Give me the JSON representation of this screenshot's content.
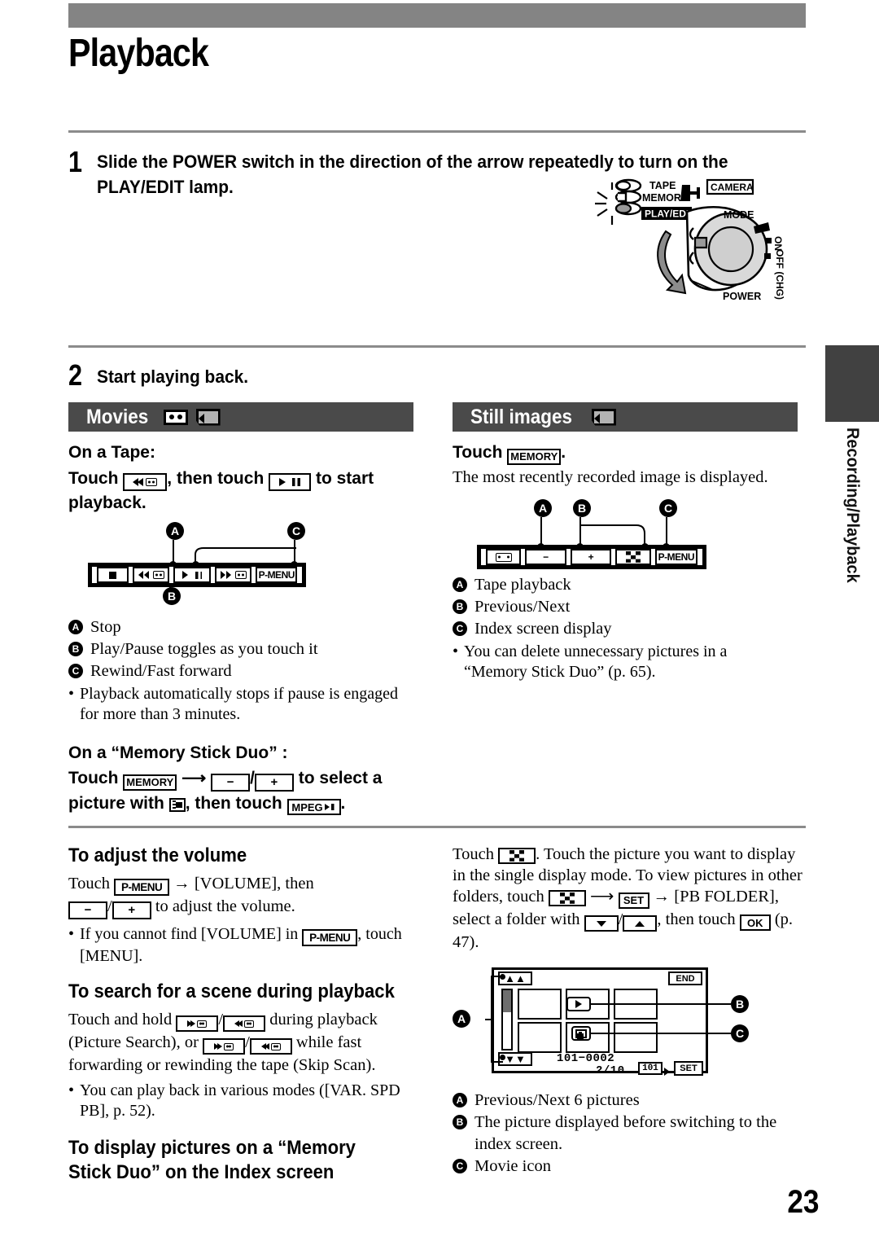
{
  "page": {
    "chapter_title": "Playback",
    "page_number": "23",
    "side_tab_label": "Recording/Playback"
  },
  "steps": [
    {
      "number": "1",
      "text": "Slide the POWER switch in the direction of the arrow repeatedly to turn on the PLAY/EDIT lamp."
    },
    {
      "number": "2",
      "text": "Start playing back."
    }
  ],
  "power_switch": {
    "lamps": [
      "TAPE",
      "MEMORY",
      "PLAY/EDIT"
    ],
    "mode_label": "MODE",
    "camera_label": "CAMERA",
    "power_label": "POWER",
    "on_label": "ON",
    "off_label": "OFF (CHG)"
  },
  "movies": {
    "bar_label": "Movies",
    "bar_icons": [
      "tape-icon",
      "memory-stick-icon"
    ],
    "tape_heading": "On a Tape:",
    "tape_instruction_pre": "Touch",
    "tape_instruction_mid": ", then touch",
    "tape_instruction_post": "to start playback.",
    "control_bar": {
      "buttons": [
        "stop",
        "rewind",
        "play-pause",
        "fast-forward",
        "P-MENU"
      ],
      "pmenu_label": "P-MENU",
      "callouts": [
        "A",
        "B",
        "C"
      ]
    },
    "legend": [
      {
        "key": "A",
        "text": "Stop"
      },
      {
        "key": "B",
        "text": "Play/Pause toggles as you touch it"
      },
      {
        "key": "C",
        "text": "Rewind/Fast forward"
      }
    ],
    "note": "Playback automatically stops if pause is engaged for more than 3 minutes.",
    "ms_heading": "On a “Memory Stick Duo” :",
    "ms_instruction_1": "Touch",
    "ms_memory_key": "MEMORY",
    "ms_minus": "−",
    "ms_plus": "+",
    "ms_instruction_2": "to select a picture with",
    "ms_instruction_3": ", then touch",
    "ms_mpeg_key": "MPEG",
    "ms_period": "."
  },
  "still_images": {
    "bar_label": "Still images",
    "bar_icons": [
      "memory-stick-icon"
    ],
    "instruction_pre": "Touch",
    "memory_key": "MEMORY",
    "instruction_post": ".",
    "description": "The most recently recorded image is displayed.",
    "control_bar": {
      "buttons": [
        "tape-playback",
        "minus",
        "plus",
        "index",
        "P-MENU"
      ],
      "minus_label": "−",
      "plus_label": "+",
      "pmenu_label": "P-MENU",
      "callouts": [
        "A",
        "B",
        "C"
      ]
    },
    "legend": [
      {
        "key": "A",
        "text": "Tape playback"
      },
      {
        "key": "B",
        "text": "Previous/Next"
      },
      {
        "key": "C",
        "text": "Index screen display"
      }
    ],
    "note": "You can delete unnecessary pictures in a “Memory Stick Duo” (p. 65)."
  },
  "volume_section": {
    "heading": "To adjust the volume",
    "line1_pre": "Touch",
    "pmenu_key": "P-MENU",
    "line1_mid": "→ [VOLUME], then",
    "minus_label": "−",
    "plus_label": "+",
    "line2_post": "to adjust the volume.",
    "note_pre": "If you cannot find [VOLUME] in",
    "note_post": ", touch [MENU]."
  },
  "search_section": {
    "heading": "To search for a scene during playback",
    "body_1": "Touch and hold",
    "body_2": "during playback (Picture Search), or",
    "body_3": "while fast forwarding or rewinding the tape (Skip Scan).",
    "note": "You can play back in various modes ([VAR. SPD PB], p. 52)."
  },
  "index_section": {
    "heading": "To display pictures on a “Memory Stick Duo” on the Index screen",
    "body_1": "Touch",
    "body_2": ". Touch the picture you want to display in the single display mode.",
    "body_3": "To view pictures in other folders, touch",
    "set_key": "SET",
    "body_4": "→ [PB FOLDER], select a folder with",
    "body_5": ", then touch",
    "ok_key": "OK",
    "body_6": "(p. 47).",
    "screen": {
      "end_label": "END",
      "file_label": "101−0002",
      "count_label": "2/10",
      "folder_label": "101",
      "set_label": "SET",
      "callouts": [
        "A",
        "B",
        "C"
      ]
    },
    "legend": [
      {
        "key": "A",
        "text": "Previous/Next 6 pictures"
      },
      {
        "key": "B",
        "text": "The picture displayed before switching to the index screen."
      },
      {
        "key": "C",
        "text": "Movie icon"
      }
    ]
  },
  "colors": {
    "top_band": "#848484",
    "section_bar": "#4a4a4a",
    "rule": "#8b8b8b",
    "tab_block": "#414141"
  }
}
